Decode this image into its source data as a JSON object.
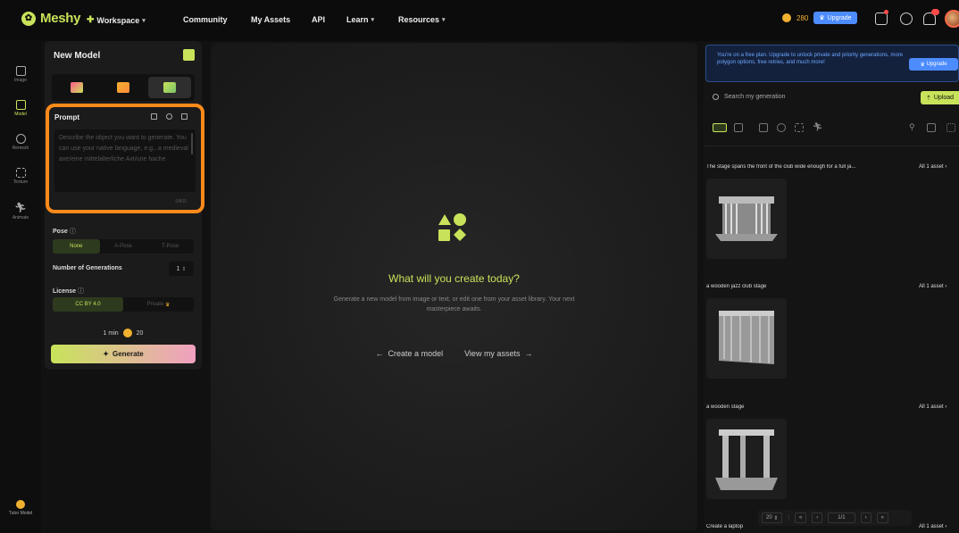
{
  "app": {
    "name": "Meshy"
  },
  "topnav": {
    "workspace": "Workspace",
    "community": "Community",
    "my_assets": "My Assets",
    "api": "API",
    "learn": "Learn",
    "resources": "Resources",
    "credits": "280",
    "upgrade": "Upgrade"
  },
  "rail": [
    {
      "label": "Image"
    },
    {
      "label": "Model"
    },
    {
      "label": "Remesh"
    },
    {
      "label": "Texture"
    },
    {
      "label": "Animate"
    }
  ],
  "tutor": {
    "label": "Tutor Model"
  },
  "panel": {
    "title": "New Model",
    "prompt_label": "Prompt",
    "prompt_placeholder": "Describe the object you want to generate. You can use your native language, e.g., a medieval axe/eine mittelalterliche Axt/une hache",
    "char_count": "0/800",
    "pose_label": "Pose",
    "pose_options": [
      "None",
      "A-Pose",
      "T-Pose"
    ],
    "ngen_label": "Number of Generations",
    "ngen_value": "1",
    "license_label": "License",
    "license_options": [
      "CC BY 4.0",
      "Private"
    ],
    "time": "1 min",
    "cost": "20",
    "generate": "Generate"
  },
  "main": {
    "title": "What will you create today?",
    "subtitle": "Generate a new model from image or text, or edit one from your asset library. Your next masterpiece awaits.",
    "create_model": "Create a model",
    "view_assets": "View my assets"
  },
  "right": {
    "banner_text": "You're on a free plan. Upgrade to unlock private and priority generations, more polygon options, free retries, and much more!",
    "banner_button": "Upgrade",
    "search_placeholder": "Search my generation",
    "upload": "Upload",
    "generations": [
      {
        "title": "The stage spans the front of the club wide enough for a full ja...",
        "count": "All 1 asset"
      },
      {
        "title": "a wooden jazz club stage",
        "count": "All 1 asset"
      },
      {
        "title": "a wooden stage",
        "count": "All 1 asset"
      },
      {
        "title": "Create a laptop",
        "count": "All 1 asset"
      }
    ],
    "page_size": "20",
    "page": "1/1"
  },
  "colors": {
    "accent": "#c8e35a",
    "highlight": "#ff8a1a",
    "blue": "#4d8cff",
    "coin": "#f0b12e"
  }
}
